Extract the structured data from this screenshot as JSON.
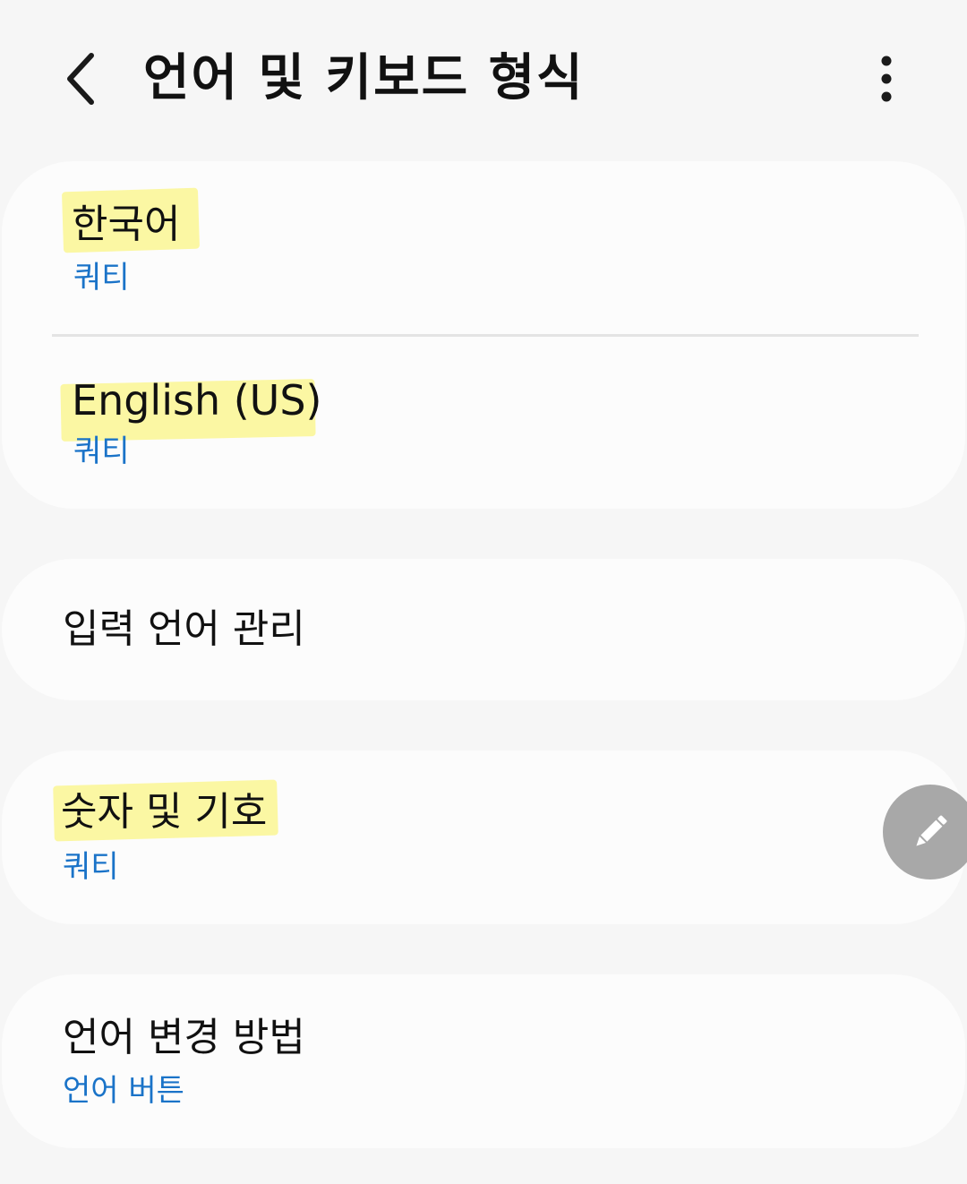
{
  "colors": {
    "background": "#f6f6f6",
    "card": "#fcfcfc",
    "subtitle_blue": "#1a73c8",
    "highlight_yellow": "#fbf7a3",
    "fab_gray": "#a8a8a8",
    "divider": "#e4e4e4"
  },
  "header": {
    "title": "언어 및 키보드 형식",
    "back_icon": "chevron-left-icon",
    "more_icon": "more-vertical-icon"
  },
  "languages": {
    "items": [
      {
        "title": "한국어",
        "subtitle": "쿼티",
        "highlighted": true
      },
      {
        "title": "English (US)",
        "subtitle": "쿼티",
        "highlighted": true
      }
    ]
  },
  "manage_input_languages": {
    "title": "입력 언어 관리"
  },
  "numbers_symbols": {
    "title": "숫자 및 기호",
    "subtitle": "쿼티",
    "highlighted": true
  },
  "language_switch": {
    "title": "언어 변경 방법",
    "subtitle": "언어 버튼"
  },
  "fab": {
    "icon": "pencil-icon"
  }
}
